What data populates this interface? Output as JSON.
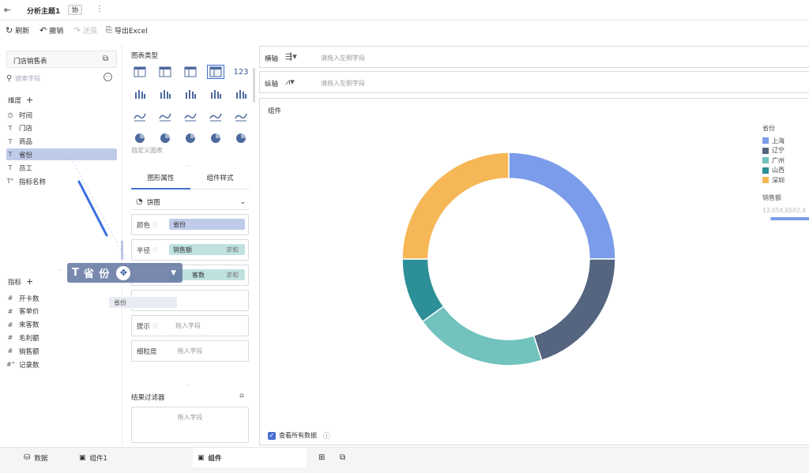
{
  "topbar": {
    "title": "分析主题1",
    "collab": "协",
    "more": "⋮"
  },
  "toolbar": {
    "refresh": "刷新",
    "undo": "撤销",
    "redo": "还原",
    "export": "导出Excel"
  },
  "left": {
    "table_name": "门店销售表",
    "search_placeholder": "搜索字段",
    "dimension_title": "维度",
    "dimensions": [
      {
        "icon": "◷",
        "label": "时间"
      },
      {
        "icon": "T",
        "label": "门店"
      },
      {
        "icon": "T",
        "label": "商品"
      },
      {
        "icon": "T",
        "label": "省份"
      },
      {
        "icon": "T",
        "label": "员工"
      },
      {
        "icon": "T°",
        "label": "指标名称"
      }
    ],
    "measure_title": "指标",
    "measures": [
      {
        "icon": "#",
        "label": "开卡数"
      },
      {
        "icon": "#",
        "label": "客单价"
      },
      {
        "icon": "#",
        "label": "来客数"
      },
      {
        "icon": "#",
        "label": "毛利额"
      },
      {
        "icon": "#",
        "label": "销售额"
      },
      {
        "icon": "#°",
        "label": "记录数"
      }
    ]
  },
  "middle": {
    "chart_type_title": "图表类型",
    "custom_chart": "自定义图表",
    "tab_props": "图形属性",
    "tab_style": "组件样式",
    "chart_kind": "饼图",
    "color_label": "颜色",
    "color_field": "省份",
    "radius_label": "半径",
    "radius_field": "销售额",
    "radius_agg": "求和",
    "angle_field": "客数",
    "angle_agg": "求和",
    "label_label": "标签",
    "tooltip_label": "提示",
    "tooltip_placeholder": "拖入字段",
    "granularity_label": "细粒度",
    "granularity_placeholder": "拖入字段",
    "filter_title": "结果过滤器",
    "filter_placeholder": "拖入字段",
    "table_icon_text": "123"
  },
  "axes": {
    "x_label": "横轴",
    "x_placeholder": "请拖入左侧字段",
    "y_label": "纵轴",
    "y_placeholder": "请拖入左侧字段"
  },
  "chart": {
    "component_title": "组件",
    "show_all_data": "查看所有数据",
    "legend_color_title": "省份",
    "legend_size_title": "销售额",
    "legend_size_range": "13,054,650",
    "legend_size_range_tail": "2,4",
    "colors": {
      "上海": "#7b9cea",
      "辽宁": "#55657f",
      "广州": "#72c2bd",
      "山西": "#2d8f98",
      "深圳": "#f6b756"
    }
  },
  "chart_data": {
    "type": "pie",
    "donut": true,
    "title": "",
    "categories": [
      "上海",
      "辽宁",
      "广州",
      "山西",
      "深圳"
    ],
    "values": [
      25,
      20,
      20,
      10,
      25
    ],
    "legend_title": "省份",
    "legend_position": "top-right"
  },
  "drag": {
    "ghost_label": "省 份",
    "ghost_icon": "T",
    "drop_hint": "省份",
    "drop_hint2": "省份"
  },
  "bottom": {
    "data_tab": "数据",
    "comp1_tab": "组件1",
    "comp_tab": "组件"
  }
}
